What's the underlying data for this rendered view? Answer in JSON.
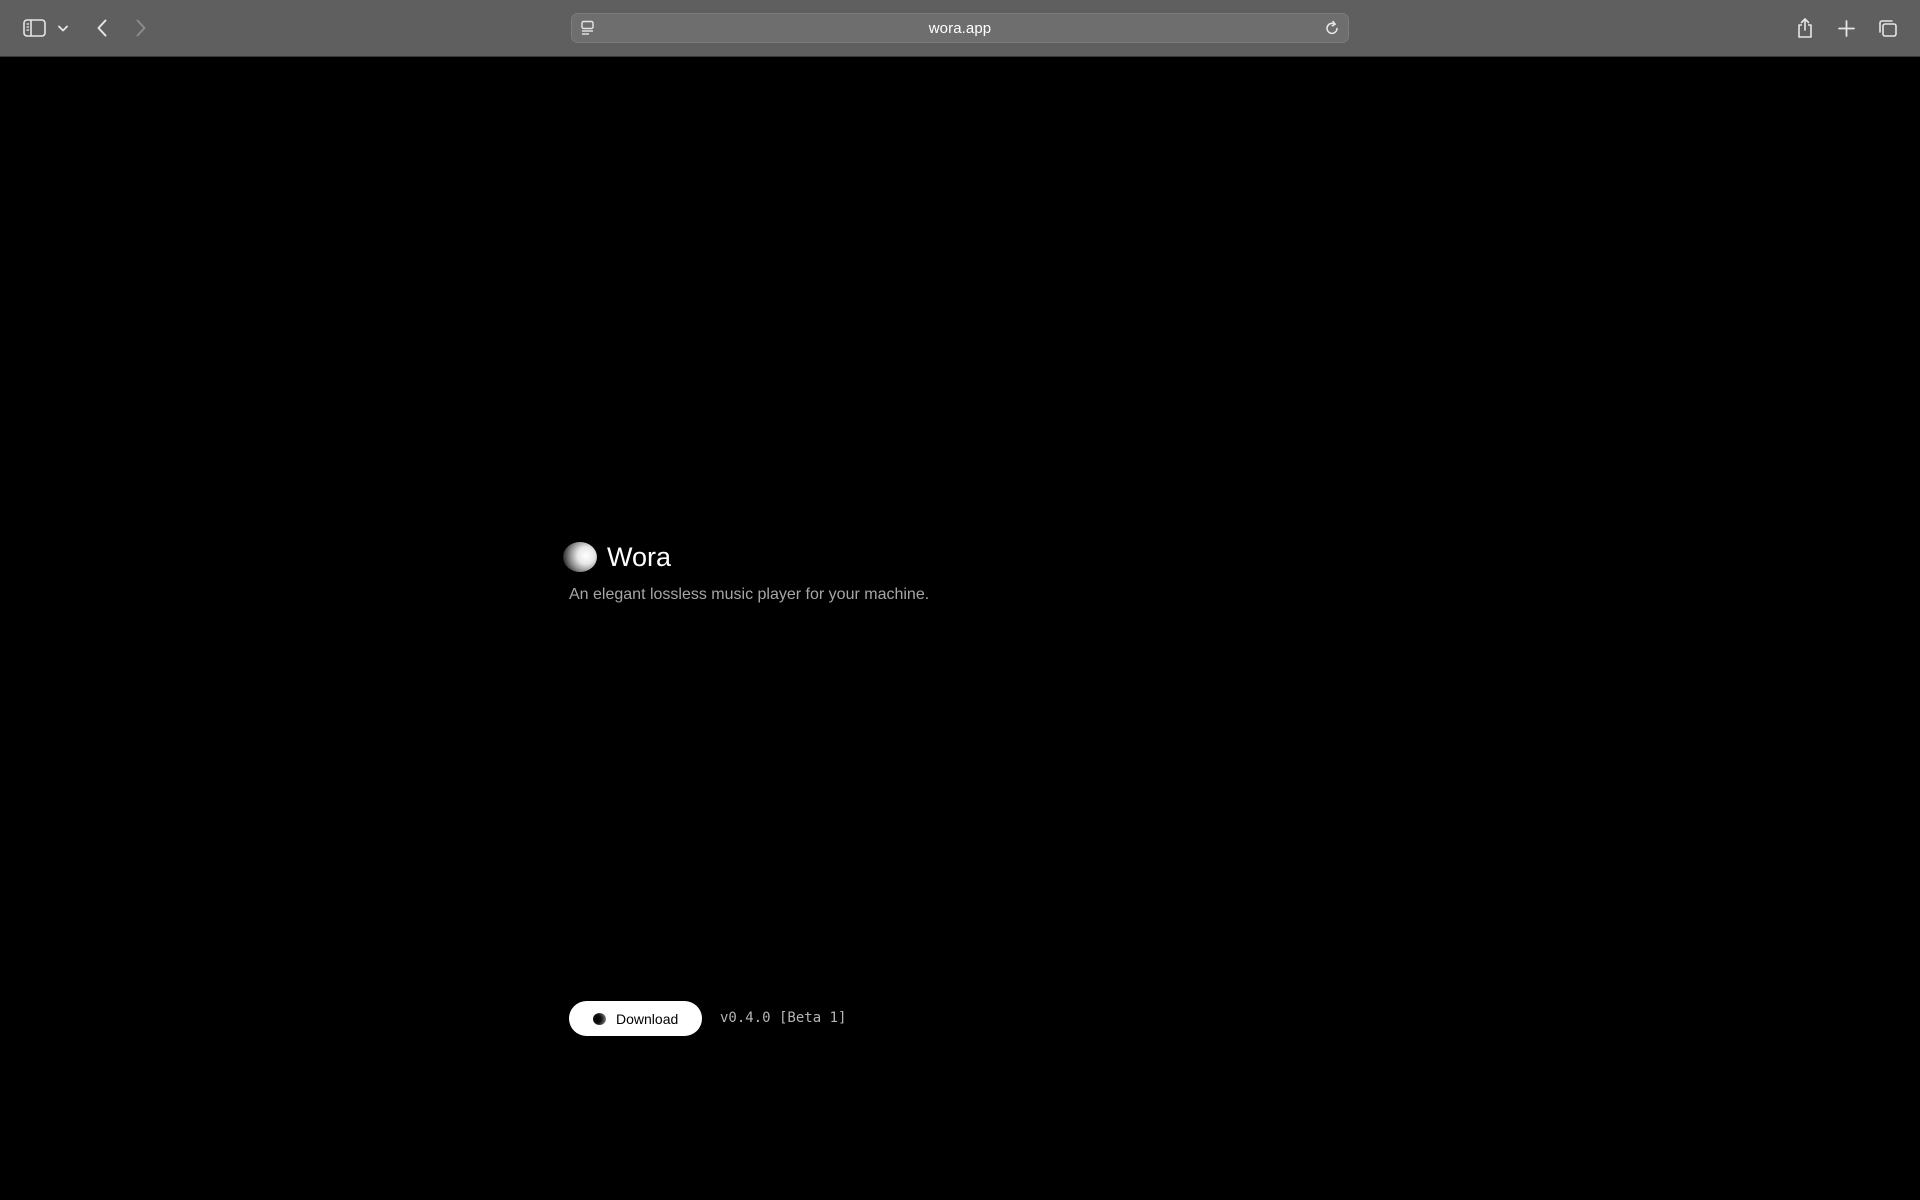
{
  "browser": {
    "url": "wora.app",
    "icons": {
      "sidebar": "sidebar-icon",
      "sidebar_menu": "chevron-down-icon",
      "back": "chevron-left-icon",
      "forward": "chevron-right-icon",
      "reader": "reader-icon",
      "reload": "reload-icon",
      "share": "share-icon",
      "new_tab": "plus-icon",
      "tab_overview": "tabs-icon"
    }
  },
  "page": {
    "brand_title": "Wora",
    "tagline": "An elegant lossless music player for your machine.",
    "download_label": "Download",
    "version": "v0.4.0 [Beta 1]"
  },
  "colors": {
    "toolbar_bg": "#5f5f5f",
    "page_bg": "#000000",
    "button_bg": "#ffffff"
  }
}
